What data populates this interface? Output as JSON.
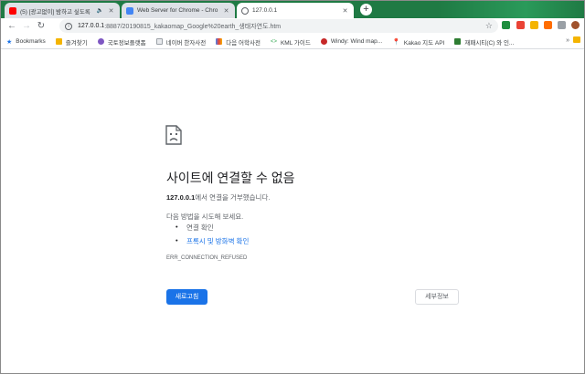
{
  "tabs": [
    {
      "title": "(5) [광고없이] 밤하고 싶도록",
      "favicon_color": "#ff0000",
      "audio": true,
      "close": "✕"
    },
    {
      "title": "Web Server for Chrome - Chro",
      "favicon_color": "#4285f4",
      "close": "✕"
    },
    {
      "title": "127.0.0.1",
      "favicon_color": "#5f6368",
      "active": true,
      "close": "✕"
    }
  ],
  "new_tab": "+",
  "toolbar": {
    "back": "←",
    "forward": "→",
    "reload": "↻",
    "url_host": "127.0.0.1",
    "url_path": ":8887/20190815_kakaomap_Google%20earth_생태자연도.htm",
    "bookmark_star": "☆"
  },
  "extensions": [
    {
      "name": "google-drive-icon",
      "color": "#1e8e3e"
    },
    {
      "name": "extension-red-icon",
      "color": "#ea4335"
    },
    {
      "name": "extension-orange-icon",
      "color": "#f4b400"
    },
    {
      "name": "extension-pdf-icon",
      "color": "#ff6d00"
    },
    {
      "name": "extension-grey-icon",
      "color": "#9aa0a6"
    },
    {
      "name": "extension-puzzle-icon",
      "color": "#5f6368"
    },
    {
      "name": "profile-avatar-icon",
      "color": "#a0522d"
    }
  ],
  "bookmarks": [
    {
      "label": "Bookmarks",
      "icon": "star-icon",
      "color": "#1a73e8"
    },
    {
      "label": "즐겨찾기",
      "icon": "folder-icon",
      "color": "#f4b400"
    },
    {
      "label": "국토정보플랫폼",
      "icon": "globe-icon",
      "color": "#7e57c2"
    },
    {
      "label": "네이버 한자사전",
      "icon": "doc-icon",
      "color": "#9aa0a6"
    },
    {
      "label": "다음 어학사전",
      "icon": "daum-icon",
      "color": "#4285f4"
    },
    {
      "label": "KML 가이드",
      "icon": "code-icon",
      "color": "#34a853"
    },
    {
      "label": "Windy: Wind map...",
      "icon": "windy-icon",
      "color": "#c62828"
    },
    {
      "label": "Kakao 지도 API",
      "icon": "pin-icon",
      "color": "#202124"
    },
    {
      "label": "재패시티(C) 와 인...",
      "icon": "chat-icon",
      "color": "#2e7d32"
    }
  ],
  "bookmark_more": "»",
  "error": {
    "title": "사이트에 연결할 수 없음",
    "host": "127.0.0.1",
    "host_suffix": "에서 연결을 거부했습니다.",
    "try_label": "다음 방법을 시도해 보세요.",
    "suggestions": [
      "연결 확인",
      "프록시 및 방화벽 확인"
    ],
    "code": "ERR_CONNECTION_REFUSED",
    "reload_button": "새로고침",
    "details_button": "세부정보"
  }
}
